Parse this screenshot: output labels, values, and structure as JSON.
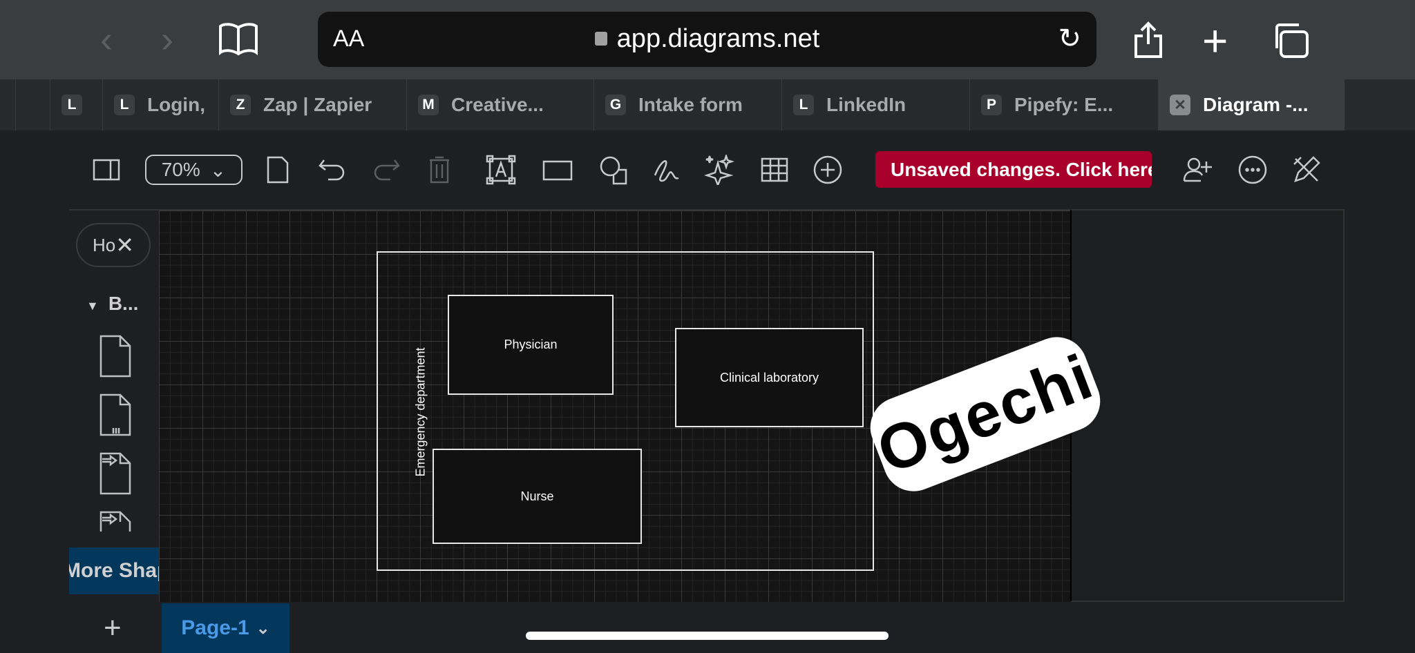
{
  "browser": {
    "url": "app.diagrams.net",
    "text_size_label": "AA",
    "tabs": [
      {
        "badge": "L",
        "label": ""
      },
      {
        "badge": "L",
        "label": "Login,"
      },
      {
        "badge": "Z",
        "label": "Zap | Zapier"
      },
      {
        "badge": "M",
        "label": "Creative..."
      },
      {
        "badge": "G",
        "label": "Intake form"
      },
      {
        "badge": "L",
        "label": "LinkedIn"
      },
      {
        "badge": "P",
        "label": "Pipefy: E..."
      },
      {
        "badge": "✕",
        "label": "Diagram -..."
      }
    ]
  },
  "toolbar": {
    "zoom": "70%",
    "unsaved": "Unsaved changes. Click here to save."
  },
  "sidebar": {
    "search": "Ho",
    "section": "B...",
    "more_shapes": "More Shapes"
  },
  "diagram": {
    "container": "Emergency department",
    "shapes": [
      "Physician",
      "Clinical laboratory",
      "Nurse"
    ],
    "sticker": "Ogechi"
  },
  "pages": {
    "current": "Page-1",
    "add": "+"
  }
}
